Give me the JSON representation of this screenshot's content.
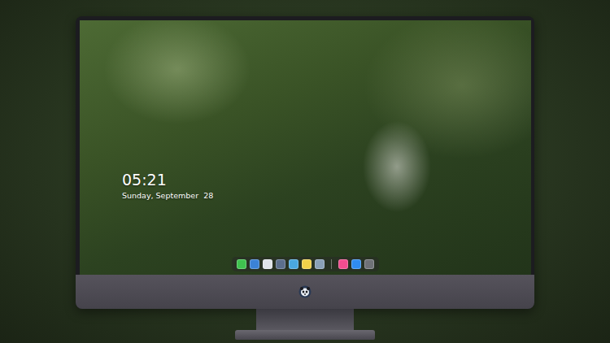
{
  "lock_screen": {
    "time": "05:21",
    "date": "Sunday, September  28"
  },
  "dock": {
    "apps": [
      {
        "color": "#3fc24f"
      },
      {
        "color": "#3b82d6"
      },
      {
        "color": "#dfe3e8"
      },
      {
        "color": "#5c6f8c"
      },
      {
        "color": "#4aa8e0"
      },
      {
        "color": "#f2d14a"
      },
      {
        "color": "#8aa0b8"
      }
    ],
    "pinned": [
      {
        "color": "#f24d8f"
      },
      {
        "color": "#2f8cf0"
      },
      {
        "color": "#6f7177"
      }
    ]
  }
}
